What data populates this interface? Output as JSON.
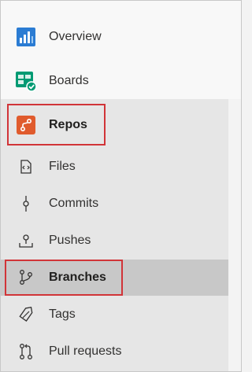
{
  "nav": {
    "overview": {
      "label": "Overview",
      "icon": "overview-icon"
    },
    "boards": {
      "label": "Boards",
      "icon": "boards-icon"
    },
    "repos": {
      "label": "Repos",
      "icon": "repos-icon"
    }
  },
  "repos_sub": {
    "files": {
      "label": "Files",
      "icon": "files-icon"
    },
    "commits": {
      "label": "Commits",
      "icon": "commit-icon"
    },
    "pushes": {
      "label": "Pushes",
      "icon": "push-icon"
    },
    "branches": {
      "label": "Branches",
      "icon": "branch-icon"
    },
    "tags": {
      "label": "Tags",
      "icon": "tag-icon"
    },
    "pull_requests": {
      "label": "Pull requests",
      "icon": "pull-request-icon"
    }
  },
  "colors": {
    "highlight": "#d13438",
    "overview_blue": "#2b7cd3",
    "boards_green": "#009a73",
    "repos_orange": "#e05b2d",
    "selected_bg": "#c8c8c8"
  }
}
